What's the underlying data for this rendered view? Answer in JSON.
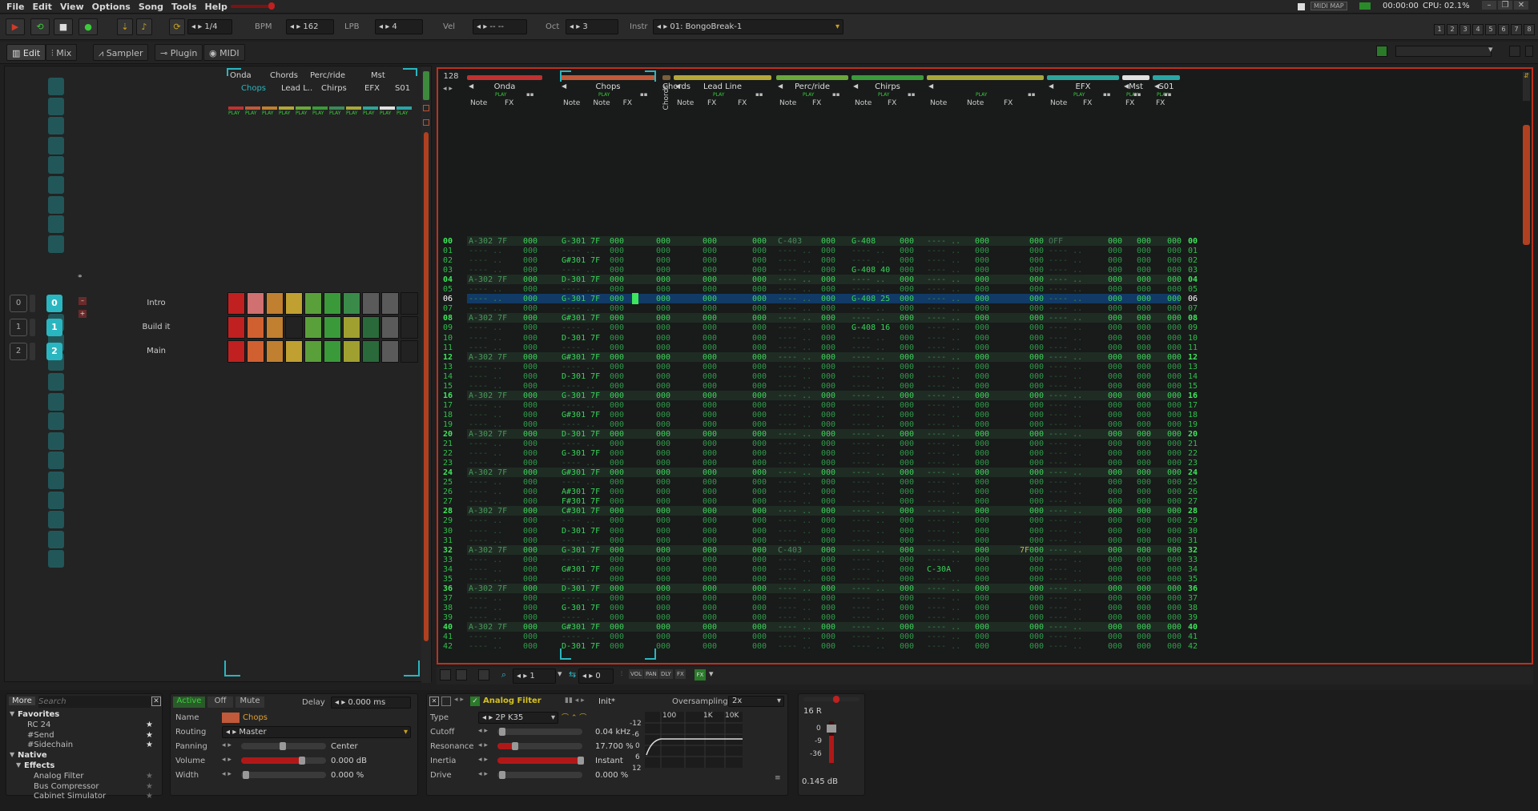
{
  "menu": {
    "items": [
      "File",
      "Edit",
      "View",
      "Options",
      "Song",
      "Tools",
      "Help"
    ]
  },
  "status": {
    "midimap": "MIDI MAP",
    "time": "00:00:00",
    "cpu": "CPU: 02.1%"
  },
  "transport": {
    "play": "▶",
    "loop": "⟲",
    "stop": "■",
    "record": "●",
    "fraction": "1/4",
    "bpm_label": "BPM",
    "bpm": "162",
    "lpb_label": "LPB",
    "lpb": "4",
    "vel_label": "Vel",
    "vel": "-- --",
    "oct_label": "Oct",
    "oct": "3",
    "instr_label": "Instr",
    "instr": "01: BongoBreak-1",
    "pages": [
      "1",
      "2",
      "3",
      "4",
      "5",
      "6",
      "7",
      "8"
    ]
  },
  "views": {
    "edit": "Edit",
    "mix": "Mix",
    "sampler": "Sampler",
    "plugin": "Plugin",
    "midi": "MIDI"
  },
  "sequencer": {
    "tracks_top": [
      "Onda",
      "Chords",
      "Perc/ride",
      "Mst"
    ],
    "tracks_bottom": [
      "Chops",
      "Lead L..",
      "Chirps",
      "EFX",
      "S01"
    ],
    "play": "PLAY",
    "sections": [
      {
        "index": "0",
        "num": "0",
        "name": "Intro"
      },
      {
        "index": "1",
        "num": "1",
        "name": "Build it"
      },
      {
        "index": "2",
        "num": "2",
        "name": "Main"
      }
    ]
  },
  "pattern": {
    "lines": "128",
    "tracks": [
      {
        "name": "Onda",
        "color": "#c03131",
        "cols": [
          "Note",
          "FX"
        ],
        "play": "PLAY"
      },
      {
        "name": "Chops",
        "color": "#c05a3a",
        "cols": [
          "Note",
          "Note",
          "FX"
        ],
        "play": "PLAY"
      },
      {
        "name": "Chords",
        "color": "#7b5f3a",
        "cols": [],
        "play": ""
      },
      {
        "name": "Lead Line",
        "color": "#b5a63a",
        "cols": [
          "Note",
          "FX",
          "FX"
        ],
        "play": "PLAY"
      },
      {
        "name": "Perc/ride",
        "color": "#6aa83a",
        "cols": [
          "Note",
          "FX"
        ],
        "play": "PLAY"
      },
      {
        "name": "Chirps",
        "color": "#3a9a3a",
        "cols": [
          "Note",
          "FX"
        ],
        "play": "PLAY"
      },
      {
        "name": "",
        "color": "#a8a83a",
        "cols": [
          "Note",
          "Note",
          "FX"
        ],
        "play": "PLAY"
      },
      {
        "name": "EFX",
        "color": "#2ea59a",
        "cols": [
          "Note",
          "FX"
        ],
        "play": "PLAY"
      },
      {
        "name": "Mst",
        "color": "#e0e0e0",
        "cols": [
          "FX"
        ],
        "play": "PLAY"
      },
      {
        "name": "S01",
        "color": "#2aa5a5",
        "cols": [
          "FX"
        ],
        "play": "PLAY"
      }
    ],
    "rows": [
      "00",
      "01",
      "02",
      "03",
      "04",
      "05",
      "06",
      "07",
      "08",
      "09",
      "10",
      "11",
      "12",
      "13",
      "14",
      "15",
      "16",
      "17",
      "18",
      "19",
      "20",
      "21",
      "22",
      "23",
      "24",
      "25",
      "26",
      "27",
      "28",
      "29",
      "30",
      "31",
      "32",
      "33",
      "34",
      "35",
      "36",
      "37",
      "38",
      "39",
      "40",
      "41",
      "42"
    ],
    "onda": {
      "0": "A-302 7F",
      "4": "A-302 7F",
      "8": "A-302 7F",
      "12": "A-302 7F",
      "16": "A-302 7F",
      "20": "A-302 7F",
      "24": "A-302 7F",
      "28": "A-302 7F",
      "32": "A-302 7F",
      "36": "A-302 7F",
      "40": "A-302 7F"
    },
    "chops": {
      "0": "G-301 7F",
      "2": "G#301 7F",
      "4": "D-301 7F",
      "6": "G-301 7F",
      "8": "G#301 7F",
      "10": "D-301 7F",
      "12": "G#301 7F",
      "14": "D-301 7F",
      "16": "G-301 7F",
      "18": "G#301 7F",
      "20": "D-301 7F",
      "22": "G-301 7F",
      "24": "G#301 7F",
      "26": "A#301 7F",
      "27": "F#301 7F",
      "28": "C#301 7F",
      "30": "D-301 7F",
      "32": "G-301 7F",
      "34": "G#301 7F",
      "36": "D-301 7F",
      "38": "G-301 7F",
      "40": "G#301 7F",
      "42": "D-301 7F"
    },
    "lead": {
      "0": "C-403",
      "32": "C-403"
    },
    "perc": {
      "0": "G-408",
      "3": "G-408 40",
      "6": "G-408 25",
      "9": "G-408 16"
    },
    "chirps": {
      "34": "C-30A"
    },
    "extra": {
      "32": "7F"
    },
    "efx": {
      "0": "OFF"
    }
  },
  "ptools": {
    "lines": "1",
    "val": "0",
    "vol": "VOL",
    "pan": "PAN",
    "dly": "DLY",
    "fx": "FX"
  },
  "browser": {
    "more": "More",
    "search_placeholder": "Search",
    "items": [
      "Favorites",
      "RC 24",
      "#Send",
      "#Sidechain",
      "Native",
      "Effects",
      "Analog Filter",
      "Bus Compressor",
      "Cabinet Simulator"
    ]
  },
  "trackprops": {
    "active": "Active",
    "off": "Off",
    "mute": "Mute",
    "delay_label": "Delay",
    "delay": "0.000 ms",
    "name_label": "Name",
    "name": "Chops",
    "routing_label": "Routing",
    "routing": "Master",
    "panning_label": "Panning",
    "panning": "Center",
    "volume_label": "Volume",
    "volume": "0.000 dB",
    "width_label": "Width",
    "width": "0.000 %"
  },
  "filter": {
    "title": "Analog Filter",
    "preset": "Init*",
    "oversampling_label": "Oversampling",
    "oversampling": "2x",
    "type_label": "Type",
    "type": "2P K35",
    "cutoff_label": "Cutoff",
    "cutoff": "0.04 kHz",
    "resonance_label": "Resonance",
    "resonance": "17.700 %",
    "inertia_label": "Inertia",
    "inertia": "Instant",
    "drive_label": "Drive",
    "drive": "0.000 %",
    "freqs": [
      "100",
      "1K",
      "10K"
    ],
    "dbs": [
      "-12",
      "-6",
      "0",
      "6",
      "12"
    ]
  },
  "meter": {
    "label": "16 R",
    "scale": [
      "0",
      "-9",
      "-36"
    ],
    "value": "0.145 dB"
  }
}
